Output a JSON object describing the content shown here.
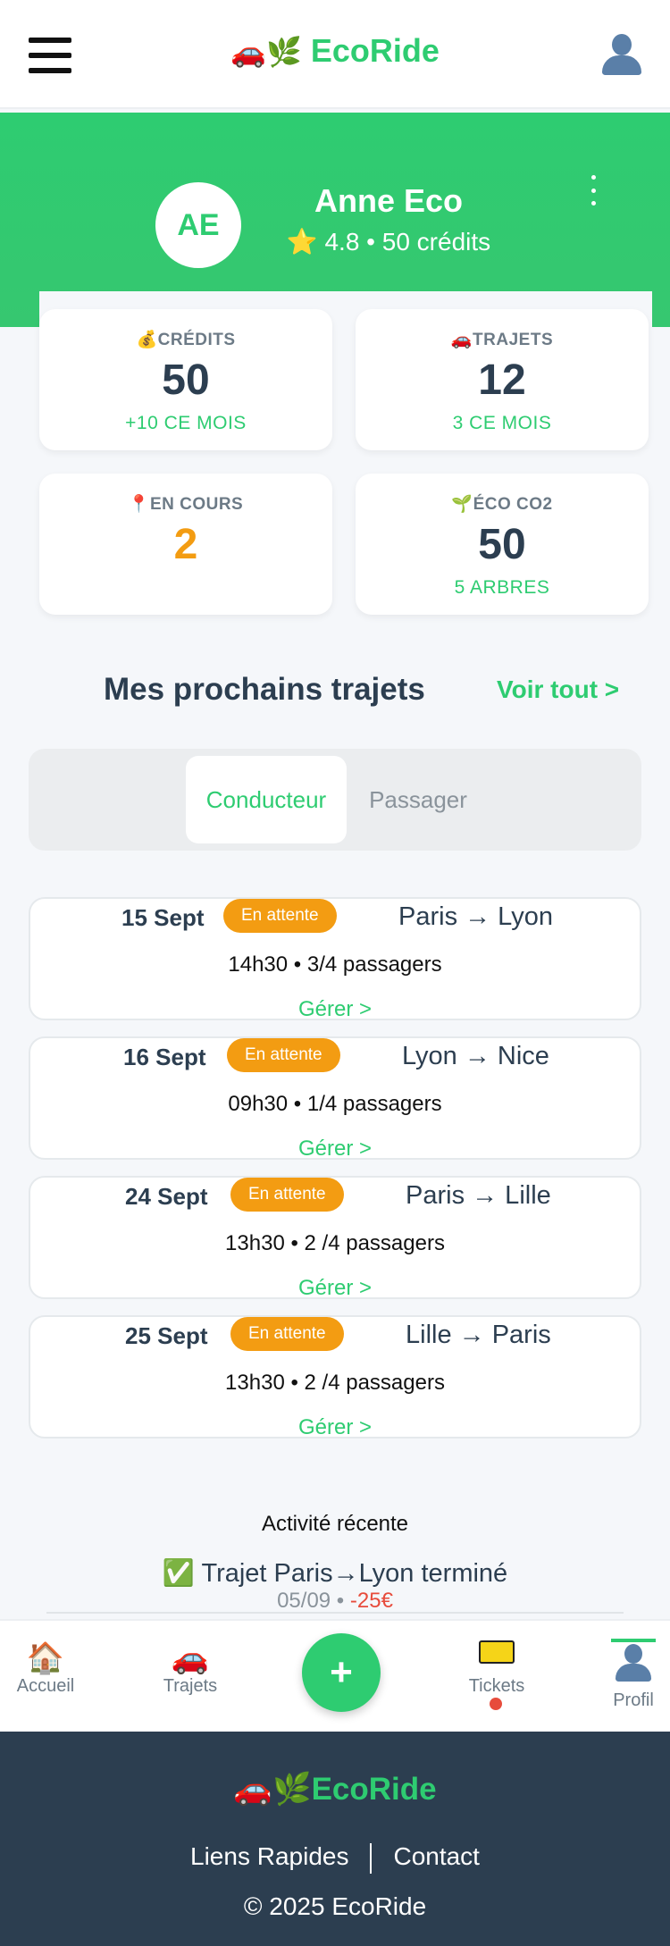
{
  "header": {
    "brand_icons": "🚗🌿",
    "brand": "EcoRide"
  },
  "profile": {
    "initials": "AE",
    "name": "Anne Eco",
    "rating_line": "⭐ 4.8 • 50 crédits"
  },
  "stats": [
    {
      "icon": "💰",
      "label": "CRÉDITS",
      "value": "50",
      "sub": "+10 CE MOIS"
    },
    {
      "icon": "🚗",
      "label": "TRAJETS",
      "value": "12",
      "sub": "3 CE MOIS"
    },
    {
      "icon": "📍",
      "label": "EN COURS",
      "value": "2",
      "sub": ""
    },
    {
      "icon": "🌱",
      "label": "ÉCO CO2",
      "value": "50",
      "sub": "5 ARBRES"
    }
  ],
  "trips_section": {
    "title": "Mes prochains trajets",
    "see_all": "Voir tout >",
    "tabs": [
      "Conducteur",
      "Passager"
    ]
  },
  "trips": [
    {
      "date": "15 Sept",
      "status": "En attente",
      "route": "Paris → Lyon",
      "info": "14h30 • 3/4 passagers",
      "action": "Gérer >"
    },
    {
      "date": "16 Sept",
      "status": "En attente",
      "route": "Lyon → Nice",
      "info": "09h30 • 1/4 passagers",
      "action": "Gérer >"
    },
    {
      "date": "24 Sept",
      "status": "En attente",
      "route": "Paris → Lille",
      "info": "13h30 • 2 /4 passagers",
      "action": "Gérer >"
    },
    {
      "date": "25 Sept",
      "status": "En attente",
      "route": "Lille → Paris",
      "info": "13h30 • 2 /4 passagers",
      "action": "Gérer >"
    }
  ],
  "activity": {
    "title": "Activité récente",
    "item": "✅ Trajet Paris→Lyon terminé",
    "date": "05/09 • ",
    "amount": "-25€"
  },
  "bottom_nav": {
    "home_icon": "🏠",
    "home": "Accueil",
    "trips_icon": "🚗",
    "trips": "Trajets",
    "add": "+",
    "tickets": "Tickets",
    "profile": "Profil"
  },
  "footer": {
    "brand_icons": "🚗🌿",
    "brand": "EcoRide",
    "link1": "Liens Rapides",
    "link2": "Contact",
    "copyright": "© 2025 EcoRide"
  },
  "colors": {
    "accent": "#2ecc71",
    "pending": "#f39c12",
    "dark": "#2c3e50",
    "negative": "#e74c3c"
  }
}
